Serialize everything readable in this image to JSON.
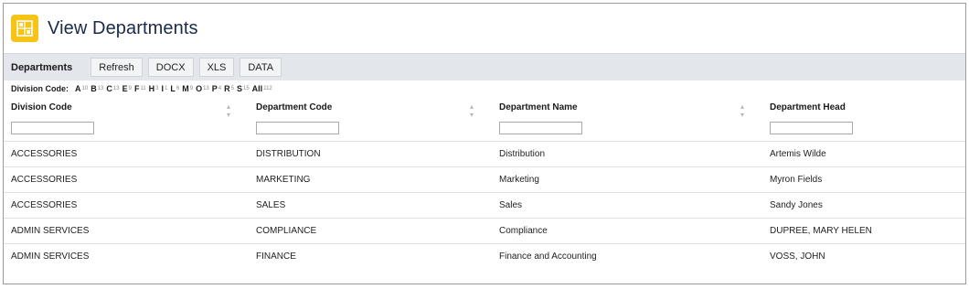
{
  "header": {
    "title": "View Departments"
  },
  "toolbar": {
    "label": "Departments",
    "buttons": [
      "Refresh",
      "DOCX",
      "XLS",
      "DATA"
    ]
  },
  "filter": {
    "label": "Division Code:",
    "letters": [
      {
        "letter": "A",
        "count": "10"
      },
      {
        "letter": "B",
        "count": "13"
      },
      {
        "letter": "C",
        "count": "13"
      },
      {
        "letter": "E",
        "count": "9"
      },
      {
        "letter": "F",
        "count": "11"
      },
      {
        "letter": "H",
        "count": "3"
      },
      {
        "letter": "I",
        "count": "1"
      },
      {
        "letter": "L",
        "count": "6"
      },
      {
        "letter": "M",
        "count": "9"
      },
      {
        "letter": "O",
        "count": "13"
      },
      {
        "letter": "P",
        "count": "4"
      },
      {
        "letter": "R",
        "count": "5"
      },
      {
        "letter": "S",
        "count": "15"
      },
      {
        "letter": "All",
        "count": "112"
      }
    ]
  },
  "table": {
    "columns": [
      "Division Code",
      "Department Code",
      "Department Name",
      "Department Head"
    ],
    "rows": [
      [
        "ACCESSORIES",
        "DISTRIBUTION",
        "Distribution",
        "Artemis Wilde"
      ],
      [
        "ACCESSORIES",
        "MARKETING",
        "Marketing",
        "Myron Fields"
      ],
      [
        "ACCESSORIES",
        "SALES",
        "Sales",
        "Sandy Jones"
      ],
      [
        "ADMIN SERVICES",
        "COMPLIANCE",
        "Compliance",
        "DUPREE, MARY HELEN"
      ],
      [
        "ADMIN SERVICES",
        "FINANCE",
        "Finance and Accounting",
        "VOSS, JOHN"
      ]
    ]
  },
  "colors": {
    "accent": "#f6c416",
    "title": "#1b2a4a",
    "toolbar_bg": "#e3e6ea"
  },
  "icons": {
    "title_icon": "building-grid-icon",
    "sort_icon": "sort-updown-icon"
  }
}
